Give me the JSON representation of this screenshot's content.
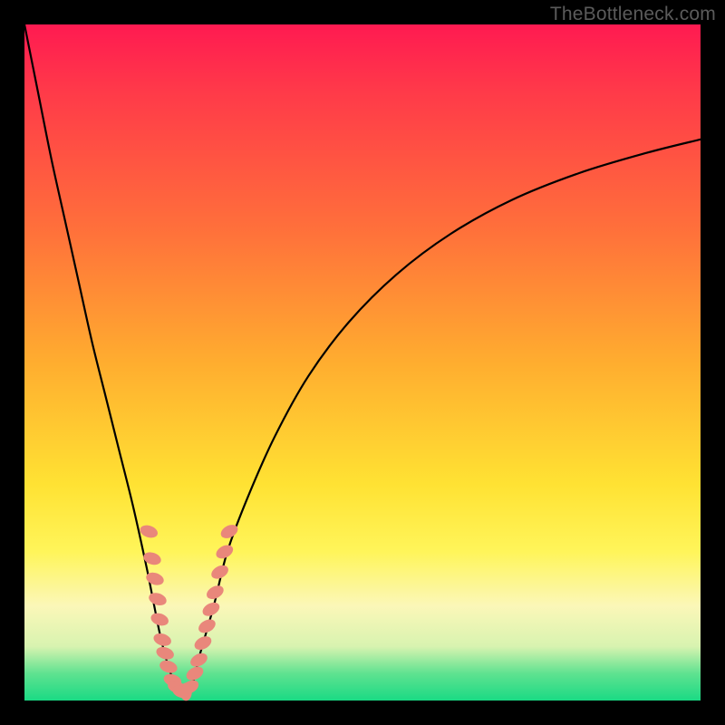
{
  "watermark": "TheBottleneck.com",
  "chart_data": {
    "type": "line",
    "title": "",
    "xlabel": "",
    "ylabel": "",
    "xlim": [
      0,
      100
    ],
    "ylim": [
      0,
      100
    ],
    "grid": false,
    "series": [
      {
        "name": "bottleneck-curve",
        "x": [
          0,
          2,
          4,
          6,
          8,
          10,
          12,
          14,
          16,
          18,
          19,
          20,
          21,
          22,
          23,
          24,
          25,
          26,
          28,
          30,
          33,
          37,
          42,
          48,
          55,
          63,
          72,
          82,
          92,
          100
        ],
        "y": [
          100,
          90,
          80,
          71,
          62,
          53,
          45,
          37,
          29,
          20,
          15,
          10,
          6,
          3,
          1,
          1,
          3,
          7,
          14,
          22,
          30,
          39,
          48,
          56,
          63,
          69,
          74,
          78,
          81,
          83
        ]
      }
    ],
    "markers": {
      "name": "data-points",
      "color": "#e9877b",
      "points": [
        {
          "x": 18.4,
          "y": 25
        },
        {
          "x": 18.9,
          "y": 21
        },
        {
          "x": 19.3,
          "y": 18
        },
        {
          "x": 19.7,
          "y": 15
        },
        {
          "x": 20.0,
          "y": 12
        },
        {
          "x": 20.4,
          "y": 9
        },
        {
          "x": 20.8,
          "y": 7
        },
        {
          "x": 21.3,
          "y": 5
        },
        {
          "x": 21.9,
          "y": 3
        },
        {
          "x": 22.5,
          "y": 2
        },
        {
          "x": 23.2,
          "y": 1.3
        },
        {
          "x": 23.9,
          "y": 1.3
        },
        {
          "x": 24.5,
          "y": 2
        },
        {
          "x": 25.2,
          "y": 4
        },
        {
          "x": 25.8,
          "y": 6
        },
        {
          "x": 26.4,
          "y": 8.5
        },
        {
          "x": 27.0,
          "y": 11
        },
        {
          "x": 27.6,
          "y": 13.5
        },
        {
          "x": 28.2,
          "y": 16
        },
        {
          "x": 28.9,
          "y": 19
        },
        {
          "x": 29.6,
          "y": 22
        },
        {
          "x": 30.3,
          "y": 25
        }
      ]
    }
  }
}
